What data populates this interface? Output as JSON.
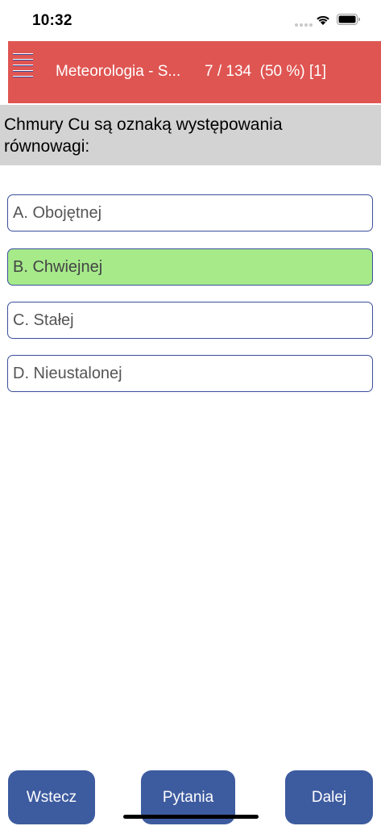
{
  "status_bar": {
    "time": "10:32"
  },
  "header": {
    "title": "Meteorologia - S...",
    "progress": "7 / 134  (50 %) [1]",
    "accent_color": "#df5552",
    "menu_icon": "hamburger-menu-icon"
  },
  "question": {
    "text": "Chmury Cu są oznaką występowania równowagi:"
  },
  "answers": [
    {
      "label": "A. Obojętnej",
      "selected": false
    },
    {
      "label": "B. Chwiejnej",
      "selected": true,
      "highlight_color": "#a6ea8a"
    },
    {
      "label": "C. Stałej",
      "selected": false
    },
    {
      "label": "D. Nieustalonej",
      "selected": false
    }
  ],
  "nav": {
    "back_label": "Wstecz",
    "questions_label": "Pytania",
    "next_label": "Dalej",
    "button_color": "#3d5b9f"
  }
}
